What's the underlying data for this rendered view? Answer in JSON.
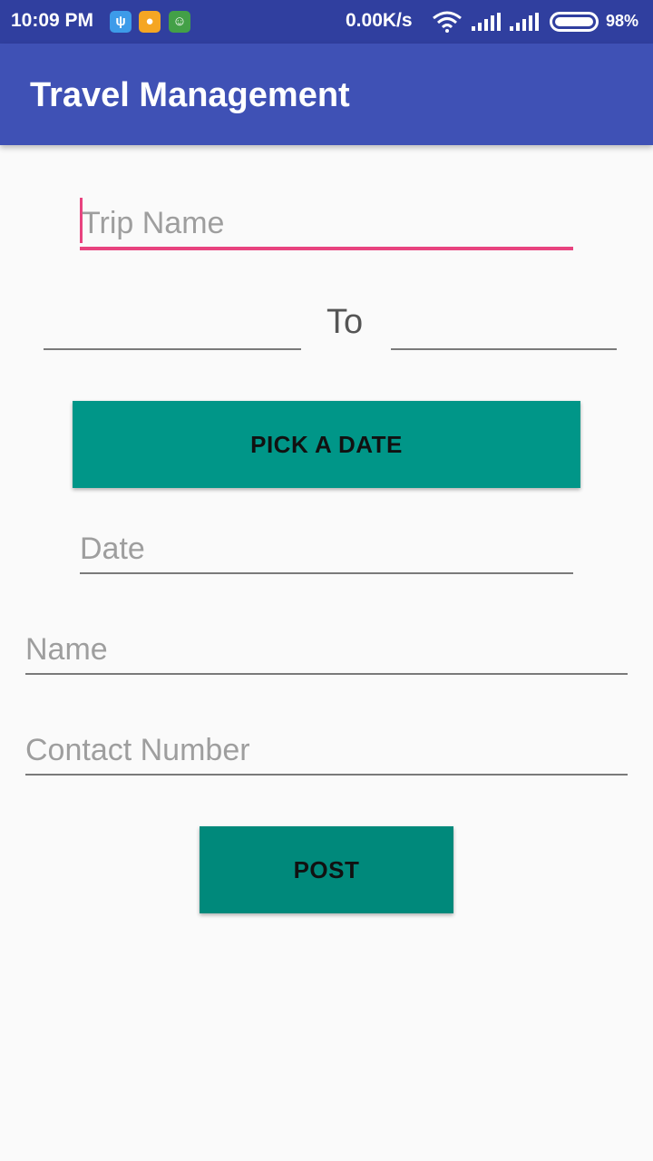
{
  "status_bar": {
    "time": "10:09 PM",
    "notification_icons": [
      "usb-icon",
      "chat-icon",
      "android-icon"
    ],
    "net_speed": "0.00K/s",
    "battery": "98%"
  },
  "app_bar": {
    "title": "Travel Management"
  },
  "form": {
    "trip_name_placeholder": "Trip Name",
    "from_value": "",
    "to_label": "To",
    "to_value": "",
    "pick_date_label": "PICK A DATE",
    "date_placeholder": "Date",
    "name_placeholder": "Name",
    "contact_placeholder": "Contact Number",
    "post_label": "POST"
  },
  "colors": {
    "status_bar": "#303f9f",
    "app_bar": "#3f51b5",
    "accent": "#e8437f",
    "button": "#009688"
  }
}
